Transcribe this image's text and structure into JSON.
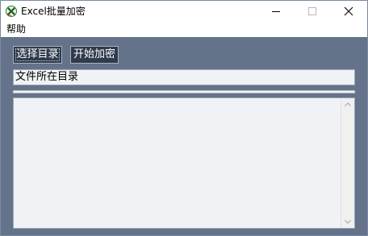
{
  "window": {
    "title": "Excel批量加密",
    "app_icon": "excel-icon",
    "controls": [
      "minimize-icon",
      "maximize-icon",
      "close-icon"
    ]
  },
  "menu": {
    "items": [
      {
        "label": "帮助"
      }
    ]
  },
  "toolbar": {
    "select_dir_label": "选择目录",
    "start_encrypt_label": "开始加密"
  },
  "path_field": {
    "value": "文件所在目录"
  },
  "progress": {
    "value_percent": 0
  },
  "log": {
    "content": ""
  },
  "colors": {
    "client_background": "#647389",
    "button_background": "#2f3b4d",
    "field_background": "#f0f2f6"
  }
}
